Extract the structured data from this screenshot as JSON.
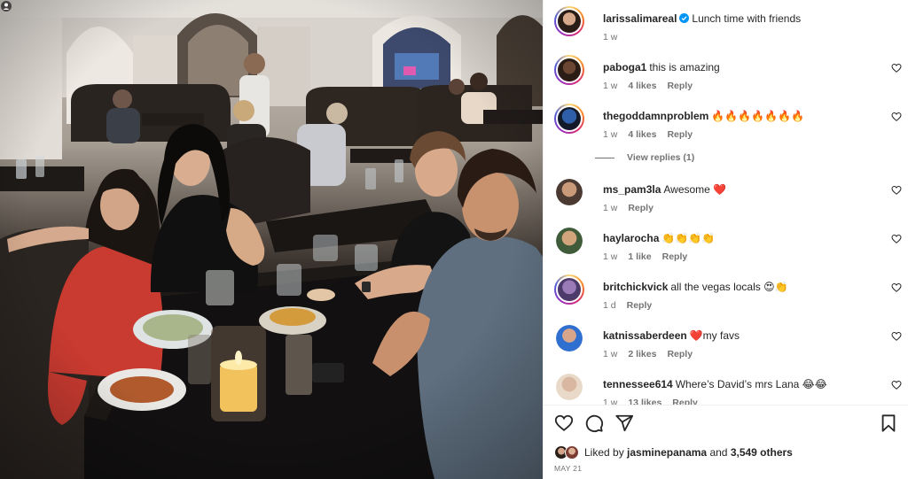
{
  "post": {
    "author": "larissalimareal",
    "caption": "Lunch time with friends",
    "age": "1 w"
  },
  "comments": [
    {
      "user": "paboga1",
      "text": "this is amazing",
      "age": "1 w",
      "likes": "4 likes",
      "reply": "Reply"
    },
    {
      "user": "thegoddamnproblem",
      "text": "🔥🔥🔥🔥🔥🔥🔥",
      "age": "1 w",
      "likes": "4 likes",
      "reply": "Reply",
      "view_replies": "View replies (1)"
    },
    {
      "user": "ms_pam3la",
      "text": "Awesome ❤️",
      "age": "1 w",
      "reply": "Reply"
    },
    {
      "user": "haylarocha",
      "text": "👏👏👏👏",
      "age": "1 w",
      "likes": "1 like",
      "reply": "Reply"
    },
    {
      "user": "britchickvick",
      "text": "all the vegas locals 😍👏",
      "age": "1 d",
      "reply": "Reply"
    },
    {
      "user": "katnissaberdeen",
      "text": "❤️my favs",
      "age": "1 w",
      "likes": "2 likes",
      "reply": "Reply"
    },
    {
      "user": "tennessee614",
      "text": "Where’s David’s mrs Lana 😂😂",
      "age": "1 w",
      "likes": "13 likes",
      "reply": "Reply"
    }
  ],
  "likes": {
    "prefix": "Liked by",
    "first_user": "jasminepanama",
    "joiner": "and",
    "others": "3,549 others"
  },
  "date": "MAY 21",
  "icons": {
    "verified": "verified-badge-icon",
    "like": "heart-icon",
    "comment": "comment-icon",
    "share": "share-icon",
    "save": "bookmark-icon",
    "comment_like": "heart-outline-icon"
  },
  "colors": {
    "verified": "#0095f6",
    "text": "#262626",
    "muted": "#737373",
    "border": "#efefef"
  }
}
